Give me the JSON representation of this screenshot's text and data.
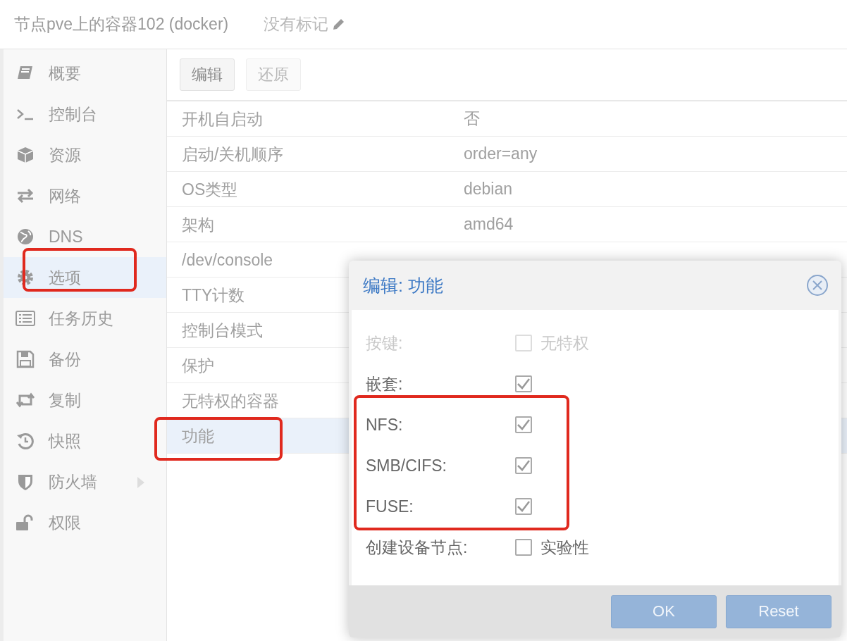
{
  "header": {
    "title": "节点pve上的容器102 (docker)",
    "tags": "没有标记"
  },
  "sidebar": {
    "items": [
      {
        "label": "概要",
        "selected": false,
        "expandable": false,
        "highlighted": false
      },
      {
        "label": "控制台",
        "selected": false,
        "expandable": false,
        "highlighted": false
      },
      {
        "label": "资源",
        "selected": false,
        "expandable": false,
        "highlighted": false
      },
      {
        "label": "网络",
        "selected": false,
        "expandable": false,
        "highlighted": false
      },
      {
        "label": "DNS",
        "selected": false,
        "expandable": false,
        "highlighted": false
      },
      {
        "label": "选项",
        "selected": true,
        "expandable": false,
        "highlighted": true
      },
      {
        "label": "任务历史",
        "selected": false,
        "expandable": false,
        "highlighted": false
      },
      {
        "label": "备份",
        "selected": false,
        "expandable": false,
        "highlighted": false
      },
      {
        "label": "复制",
        "selected": false,
        "expandable": false,
        "highlighted": false
      },
      {
        "label": "快照",
        "selected": false,
        "expandable": false,
        "highlighted": false
      },
      {
        "label": "防火墙",
        "selected": false,
        "expandable": true,
        "highlighted": false
      },
      {
        "label": "权限",
        "selected": false,
        "expandable": false,
        "highlighted": false
      }
    ]
  },
  "toolbar": {
    "buttons": [
      {
        "label": "编辑",
        "disabled": false
      },
      {
        "label": "还原",
        "disabled": true
      }
    ]
  },
  "table": {
    "rows": [
      {
        "key": "开机自启动",
        "value": "否",
        "selected": false,
        "highlighted": false
      },
      {
        "key": "启动/关机顺序",
        "value": "order=any",
        "selected": false,
        "highlighted": false
      },
      {
        "key": "OS类型",
        "value": "debian",
        "selected": false,
        "highlighted": false
      },
      {
        "key": "架构",
        "value": "amd64",
        "selected": false,
        "highlighted": false
      },
      {
        "key": "/dev/console",
        "selected": false,
        "highlighted": false
      },
      {
        "key": "TTY计数",
        "selected": false,
        "highlighted": false
      },
      {
        "key": "控制台模式",
        "selected": false,
        "highlighted": false
      },
      {
        "key": "保护",
        "selected": false,
        "highlighted": false
      },
      {
        "key": "无特权的容器",
        "selected": false,
        "highlighted": false
      },
      {
        "key": "功能",
        "selected": true,
        "highlighted": true
      }
    ]
  },
  "dialog": {
    "title": "编辑: 功能",
    "fields": [
      {
        "label": "按键:",
        "checked": false,
        "disabled": true,
        "box_label": "无特权",
        "highlighted": false
      },
      {
        "label": "嵌套:",
        "checked": true,
        "disabled": false,
        "highlighted": false
      },
      {
        "label": "NFS:",
        "checked": true,
        "disabled": false,
        "highlighted": true
      },
      {
        "label": "SMB/CIFS:",
        "checked": true,
        "disabled": false,
        "highlighted": true
      },
      {
        "label": "FUSE:",
        "checked": true,
        "disabled": false,
        "highlighted": true
      },
      {
        "label": "创建设备节点:",
        "checked": false,
        "disabled": false,
        "box_label": "实验性",
        "highlighted": false
      }
    ],
    "buttons": [
      {
        "label": "OK",
        "disabled": true
      },
      {
        "label": "Reset",
        "disabled": true
      }
    ]
  }
}
